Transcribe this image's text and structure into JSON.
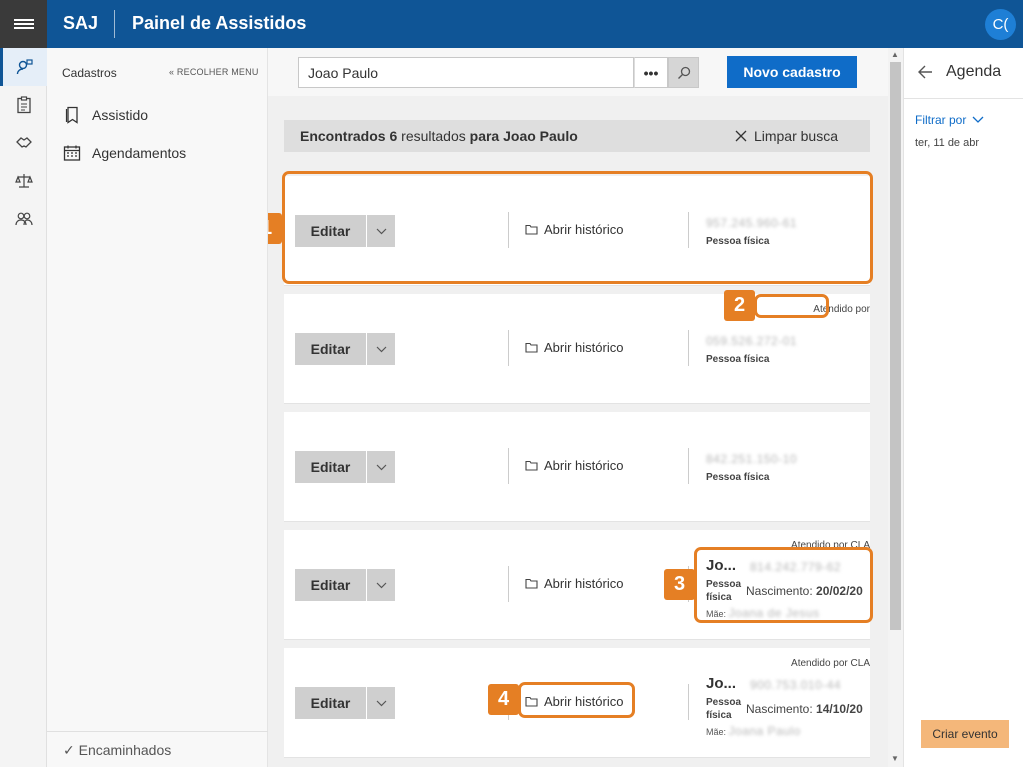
{
  "topbar": {
    "brand": "SAJ",
    "title": "Painel de Assistidos",
    "avatar_initials": "C("
  },
  "rail": {
    "icons": [
      "person-search-icon",
      "clipboard-icon",
      "handshake-icon",
      "scales-icon",
      "group-icon"
    ]
  },
  "sidenav": {
    "heading": "Cadastros",
    "collapse_label": "RECOLHER MENU",
    "items": [
      {
        "label": "Assistido",
        "icon": "bookmark-icon"
      },
      {
        "label": "Agendamentos",
        "icon": "calendar-icon"
      }
    ],
    "bottom_item": "Encaminhados"
  },
  "search": {
    "value": "Joao Paulo",
    "more_label": "•••",
    "new_button": "Novo cadastro"
  },
  "results": {
    "prefix": "Encontrados",
    "count": "6",
    "middle": "resultados",
    "para": "para",
    "query": "Joao Paulo",
    "clear_label": "Limpar busca"
  },
  "cards": [
    {
      "edit": "Editar",
      "history": "Abrir histórico",
      "cpf": "957.245.960-61",
      "type": "Pessoa física"
    },
    {
      "edit": "Editar",
      "history": "Abrir histórico",
      "cpf": "059.526.272-01",
      "type": "Pessoa física",
      "attended": "Atendido por"
    },
    {
      "edit": "Editar",
      "history": "Abrir histórico",
      "cpf": "842.251.150-10",
      "type": "Pessoa física"
    },
    {
      "edit": "Editar",
      "history": "Abrir histórico",
      "name": "Jo...",
      "cpf": "814.242.779-62",
      "type_line1": "Pessoa",
      "type_line2": "física",
      "nasc_label": "Nascimento:",
      "nasc_value": "20/02/20",
      "mae_label": "Mãe:",
      "mae_value": "Joana de Jesus",
      "attended": "Atendido por CLA"
    },
    {
      "edit": "Editar",
      "history": "Abrir histórico",
      "name": "Jo...",
      "cpf": "900.753.010-44",
      "type_line1": "Pessoa",
      "type_line2": "física",
      "nasc_label": "Nascimento:",
      "nasc_value": "14/10/20",
      "mae_label": "Mãe:",
      "mae_value": "Joana Paulo",
      "attended": "Atendido por CLA"
    }
  ],
  "callouts": [
    "1",
    "2",
    "3",
    "4"
  ],
  "agenda": {
    "title": "Agenda",
    "filter": "Filtrar por",
    "date": "ter, 11 de abr",
    "create_button": "Criar evento"
  },
  "colors": {
    "topbar": "#0f5596",
    "primary": "#0f6cc8",
    "callout": "#e57f24",
    "create": "#f4b77a"
  }
}
